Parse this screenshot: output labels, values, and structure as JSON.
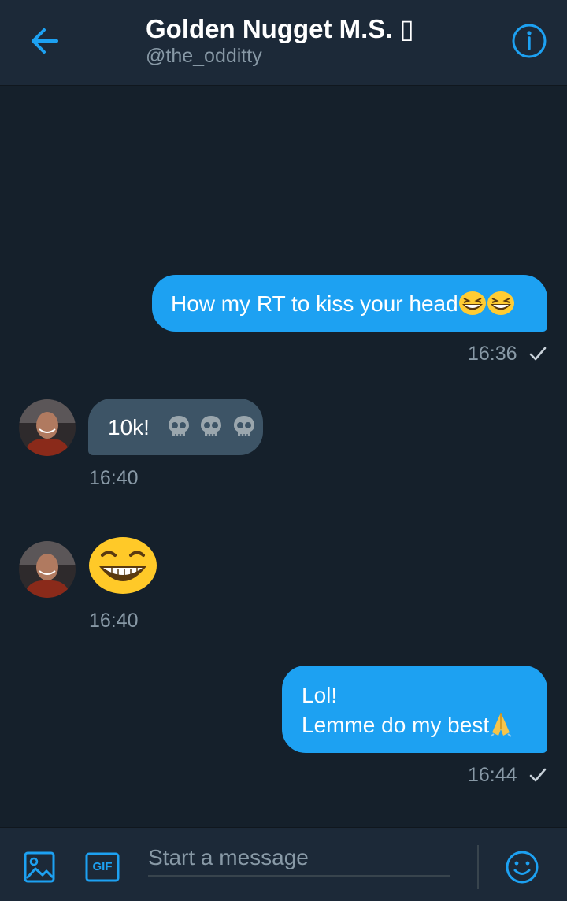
{
  "header": {
    "title": "Golden Nugget M.S. ▯",
    "handle": "@the_odditty"
  },
  "messages": [
    {
      "direction": "out",
      "text": "How my RT to kiss your head",
      "emoji": [
        "grinning-squint-face",
        "grinning-squint-face"
      ],
      "time": "16:36",
      "status": "sent-check"
    },
    {
      "direction": "in",
      "text": "10k!",
      "emoji": [
        "skull",
        "skull",
        "skull"
      ],
      "time": "16:40"
    },
    {
      "direction": "in",
      "text": "",
      "emoji": [
        "laughing-face"
      ],
      "time": "16:40"
    },
    {
      "direction": "out",
      "line1": "Lol!",
      "line2": "Lemme do my best",
      "emoji": [
        "folded-hands"
      ],
      "time": "16:44",
      "status": "sent-check"
    }
  ],
  "composer": {
    "placeholder": "Start a message",
    "gif_label": "GIF"
  },
  "colors": {
    "background": "#15202b",
    "header": "#1c2938",
    "accent": "#1da1f2",
    "incoming_bubble": "#3d5466",
    "muted_text": "#8899a6"
  },
  "icons": [
    "back-arrow-icon",
    "info-icon",
    "image-icon",
    "gif-icon",
    "emoji-icon",
    "check-icon"
  ]
}
